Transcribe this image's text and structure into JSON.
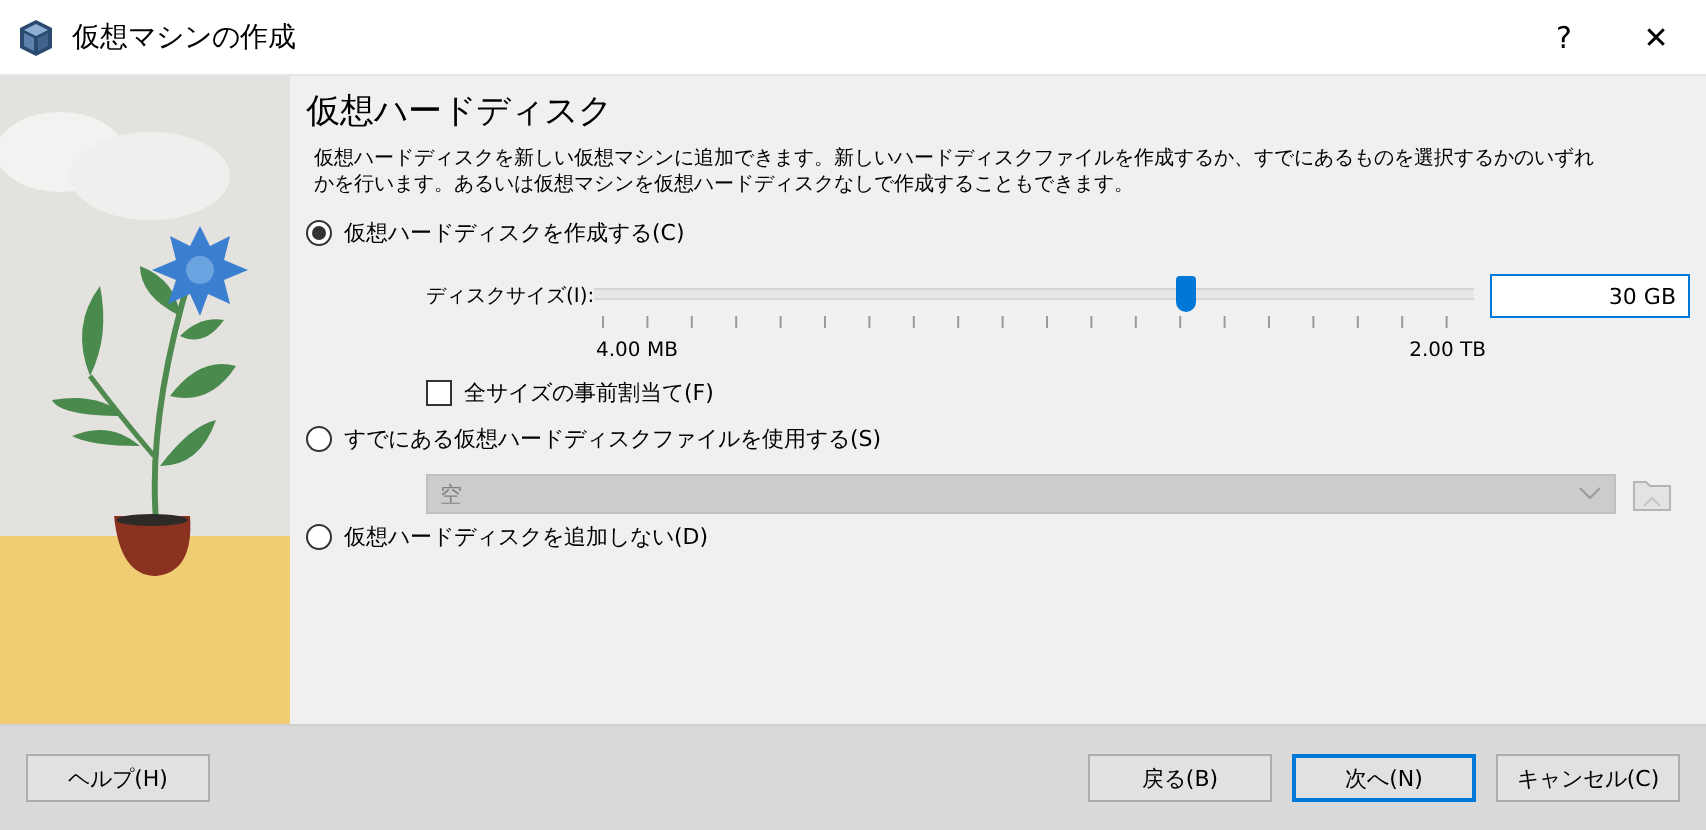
{
  "window": {
    "title": "仮想マシンの作成",
    "help_button": "?",
    "close_button": "✕"
  },
  "heading": "仮想ハードディスク",
  "description": "仮想ハードディスクを新しい仮想マシンに追加できます。新しいハードディスクファイルを作成するか、すでにあるものを選択するかのいずれかを行います。あるいは仮想マシンを仮想ハードディスクなしで作成することもできます。",
  "options": [
    {
      "label": "仮想ハードディスクを作成する(C)",
      "selected": true,
      "kind": "create"
    },
    {
      "label": "すでにある仮想ハードディスクファイルを使用する(S)",
      "selected": false,
      "kind": "existing"
    },
    {
      "label": "仮想ハードディスクを追加しない(D)",
      "selected": false,
      "kind": "none"
    }
  ],
  "disk_size": {
    "label": "ディスクサイズ(I):",
    "level": 0.672,
    "value": "30 GB",
    "min_label": "4.00 MB",
    "max_label": "2.00 TB"
  },
  "preallocate": {
    "label": "全サイズの事前割当て(F)",
    "checked": false
  },
  "existing_file": {
    "value": "空",
    "disabled": true
  },
  "buttons": {
    "help": "ヘルプ(H)",
    "back": "戻る(B)",
    "next": "次へ(N)",
    "cancel": "キャンセル(C)"
  }
}
